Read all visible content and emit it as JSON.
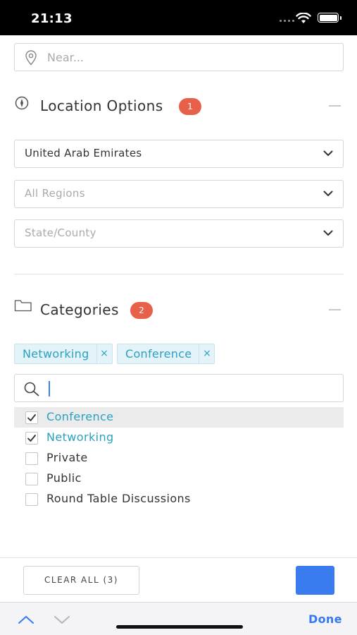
{
  "status_bar": {
    "time": "21:13"
  },
  "near_search": {
    "placeholder": "Near..."
  },
  "location_options": {
    "title": "Location Options",
    "badge": "1",
    "country": {
      "value": "United Arab Emirates"
    },
    "region": {
      "placeholder": "All Regions"
    },
    "state": {
      "placeholder": "State/County"
    }
  },
  "categories": {
    "title": "Categories",
    "badge": "2",
    "selected_tags": [
      {
        "label": "Networking",
        "remove": "×"
      },
      {
        "label": "Conference",
        "remove": "×"
      }
    ],
    "search": {
      "value": ""
    },
    "items": [
      {
        "label": "Conference",
        "checked": true
      },
      {
        "label": "Networking",
        "checked": true
      },
      {
        "label": "Private",
        "checked": false
      },
      {
        "label": "Public",
        "checked": false
      },
      {
        "label": "Round Table Discussions",
        "checked": false
      }
    ]
  },
  "footer": {
    "clear_label": "CLEAR ALL (3)"
  },
  "keyboard_toolbar": {
    "done_label": "Done"
  },
  "colors": {
    "accent": "#2aa1c2",
    "badge": "#e8604a",
    "primary_button": "#3b7bf0",
    "done": "#3478f6"
  }
}
